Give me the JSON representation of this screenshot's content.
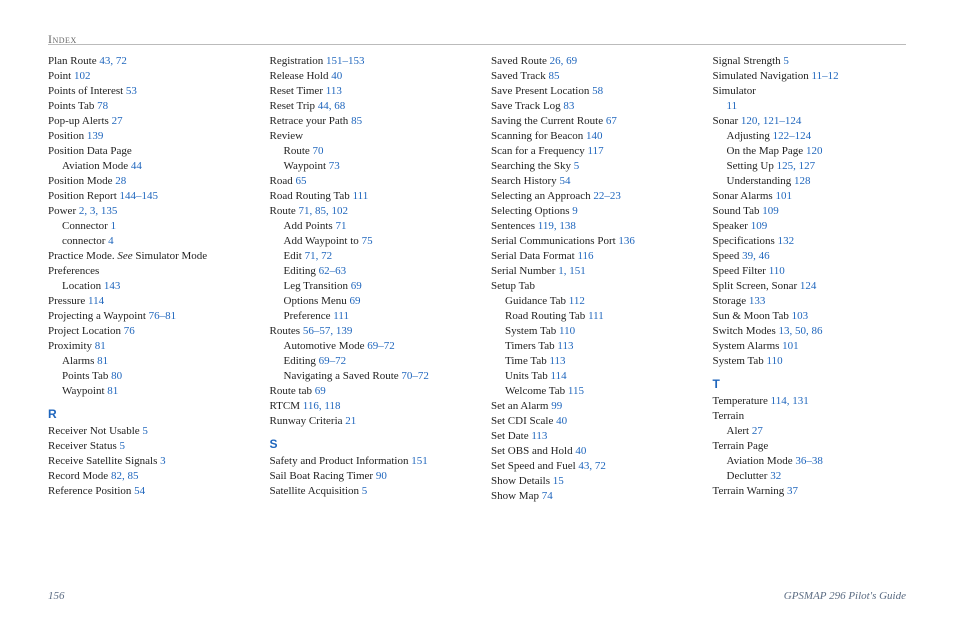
{
  "header": {
    "label": "Index"
  },
  "footer": {
    "page_number": "156",
    "book_title": "GPSMAP 296 Pilot's Guide"
  },
  "columns": [
    {
      "items": [
        {
          "type": "entry",
          "text": "Plan Route",
          "pages": "43, 72"
        },
        {
          "type": "entry",
          "text": "Point",
          "pages": "102"
        },
        {
          "type": "entry",
          "text": "Points of Interest",
          "pages": "53"
        },
        {
          "type": "entry",
          "text": "Points Tab",
          "pages": "78"
        },
        {
          "type": "entry",
          "text": "Pop-up Alerts",
          "pages": "27"
        },
        {
          "type": "entry",
          "text": "Position",
          "pages": "139"
        },
        {
          "type": "entry",
          "text": "Position Data Page"
        },
        {
          "type": "entry",
          "indent": 1,
          "text": "Aviation Mode",
          "pages": "44"
        },
        {
          "type": "entry",
          "text": "Position Mode",
          "pages": "28"
        },
        {
          "type": "entry",
          "text": "Position Report",
          "pages": "144–145"
        },
        {
          "type": "entry",
          "text": "Power",
          "pages": "2, 3, 135"
        },
        {
          "type": "entry",
          "indent": 1,
          "text": "Connector",
          "pages": "1"
        },
        {
          "type": "entry",
          "indent": 1,
          "text": "connector",
          "pages": "4"
        },
        {
          "type": "entry",
          "text": "Practice Mode. ",
          "see": "See",
          "see_target": " Simulator Mode"
        },
        {
          "type": "entry",
          "text": "Preferences"
        },
        {
          "type": "entry",
          "indent": 1,
          "text": "Location",
          "pages": "143"
        },
        {
          "type": "entry",
          "text": "Pressure",
          "pages": "114"
        },
        {
          "type": "entry",
          "text": "Projecting a Waypoint",
          "pages": "76–81"
        },
        {
          "type": "entry",
          "text": "Project Location",
          "pages": "76"
        },
        {
          "type": "entry",
          "text": "Proximity",
          "pages": "81"
        },
        {
          "type": "entry",
          "indent": 1,
          "text": "Alarms",
          "pages": "81"
        },
        {
          "type": "entry",
          "indent": 1,
          "text": "Points Tab",
          "pages": "80"
        },
        {
          "type": "entry",
          "indent": 1,
          "text": "Waypoint",
          "pages": "81"
        },
        {
          "type": "section",
          "letter": "R"
        },
        {
          "type": "entry",
          "text": "Receiver Not Usable",
          "pages": "5"
        },
        {
          "type": "entry",
          "text": "Receiver Status",
          "pages": "5"
        },
        {
          "type": "entry",
          "text": "Receive Satellite Signals",
          "pages": "3"
        },
        {
          "type": "entry",
          "text": "Record Mode",
          "pages": "82, 85"
        },
        {
          "type": "entry",
          "text": "Reference Position",
          "pages": "54"
        }
      ]
    },
    {
      "items": [
        {
          "type": "entry",
          "text": "Registration",
          "pages": "151–153"
        },
        {
          "type": "entry",
          "text": "Release Hold",
          "pages": "40"
        },
        {
          "type": "entry",
          "text": "Reset Timer",
          "pages": "113"
        },
        {
          "type": "entry",
          "text": "Reset Trip",
          "pages": "44, 68"
        },
        {
          "type": "entry",
          "text": "Retrace your Path",
          "pages": "85"
        },
        {
          "type": "entry",
          "text": "Review"
        },
        {
          "type": "entry",
          "indent": 1,
          "text": "Route",
          "pages": "70"
        },
        {
          "type": "entry",
          "indent": 1,
          "text": "Waypoint",
          "pages": "73"
        },
        {
          "type": "entry",
          "text": "Road",
          "pages": "65"
        },
        {
          "type": "entry",
          "text": "Road Routing Tab",
          "pages": "111"
        },
        {
          "type": "entry",
          "text": "Route",
          "pages": "71, 85, 102"
        },
        {
          "type": "entry",
          "indent": 1,
          "text": "Add Points",
          "pages": "71"
        },
        {
          "type": "entry",
          "indent": 1,
          "text": "Add Waypoint to",
          "pages": "75"
        },
        {
          "type": "entry",
          "indent": 1,
          "text": "Edit",
          "pages": "71, 72"
        },
        {
          "type": "entry",
          "indent": 1,
          "text": "Editing",
          "pages": "62–63"
        },
        {
          "type": "entry",
          "indent": 1,
          "text": "Leg Transition",
          "pages": "69"
        },
        {
          "type": "entry",
          "indent": 1,
          "text": "Options Menu",
          "pages": "69"
        },
        {
          "type": "entry",
          "indent": 1,
          "text": "Preference",
          "pages": "111"
        },
        {
          "type": "entry",
          "text": "Routes",
          "pages": "56–57, 139"
        },
        {
          "type": "entry",
          "indent": 1,
          "text": "Automotive Mode",
          "pages": "69–72"
        },
        {
          "type": "entry",
          "indent": 1,
          "text": "Editing",
          "pages": "69–72"
        },
        {
          "type": "entry",
          "indent": 1,
          "text": "Navigating a Saved Route",
          "pages": "70–72"
        },
        {
          "type": "entry",
          "text": "Route tab",
          "pages": "69"
        },
        {
          "type": "entry",
          "text": "RTCM",
          "pages": "116, 118"
        },
        {
          "type": "entry",
          "text": "Runway Criteria",
          "pages": "21"
        },
        {
          "type": "section",
          "letter": "S"
        },
        {
          "type": "entry",
          "text": "Safety and Product Information",
          "pages": "151"
        },
        {
          "type": "entry",
          "text": "Sail Boat Racing Timer",
          "pages": "90"
        },
        {
          "type": "entry",
          "text": "Satellite Acquisition",
          "pages": "5"
        }
      ]
    },
    {
      "items": [
        {
          "type": "entry",
          "text": "Saved Route",
          "pages": "26, 69"
        },
        {
          "type": "entry",
          "text": "Saved Track",
          "pages": "85"
        },
        {
          "type": "entry",
          "text": "Save Present Location",
          "pages": "58"
        },
        {
          "type": "entry",
          "text": "Save Track Log",
          "pages": "83"
        },
        {
          "type": "entry",
          "text": "Saving the Current Route",
          "pages": "67"
        },
        {
          "type": "entry",
          "text": "Scanning for Beacon",
          "pages": "140"
        },
        {
          "type": "entry",
          "text": "Scan for a Frequency",
          "pages": "117"
        },
        {
          "type": "entry",
          "text": "Searching the Sky",
          "pages": "5"
        },
        {
          "type": "entry",
          "text": "Search History",
          "pages": "54"
        },
        {
          "type": "entry",
          "text": "Selecting an Approach",
          "pages": "22–23"
        },
        {
          "type": "entry",
          "text": "Selecting Options",
          "pages": "9"
        },
        {
          "type": "entry",
          "text": "Sentences",
          "pages": "119, 138"
        },
        {
          "type": "entry",
          "text": "Serial Communications Port",
          "pages": "136"
        },
        {
          "type": "entry",
          "text": "Serial Data Format",
          "pages": "116"
        },
        {
          "type": "entry",
          "text": "Serial Number",
          "pages": "1, 151"
        },
        {
          "type": "entry",
          "text": "Setup Tab"
        },
        {
          "type": "entry",
          "indent": 1,
          "text": "Guidance Tab",
          "pages": "112"
        },
        {
          "type": "entry",
          "indent": 1,
          "text": "Road Routing Tab",
          "pages": "111"
        },
        {
          "type": "entry",
          "indent": 1,
          "text": "System Tab",
          "pages": "110"
        },
        {
          "type": "entry",
          "indent": 1,
          "text": "Timers Tab",
          "pages": "113"
        },
        {
          "type": "entry",
          "indent": 1,
          "text": "Time Tab",
          "pages": "113"
        },
        {
          "type": "entry",
          "indent": 1,
          "text": "Units Tab",
          "pages": "114"
        },
        {
          "type": "entry",
          "indent": 1,
          "text": "Welcome Tab",
          "pages": "115"
        },
        {
          "type": "entry",
          "text": "Set an Alarm",
          "pages": "99"
        },
        {
          "type": "entry",
          "text": "Set CDI Scale",
          "pages": "40"
        },
        {
          "type": "entry",
          "text": "Set Date",
          "pages": "113"
        },
        {
          "type": "entry",
          "text": "Set OBS and Hold",
          "pages": "40"
        },
        {
          "type": "entry",
          "text": "Set Speed and Fuel",
          "pages": "43, 72"
        },
        {
          "type": "entry",
          "text": "Show Details",
          "pages": "15"
        },
        {
          "type": "entry",
          "text": "Show Map",
          "pages": "74"
        }
      ]
    },
    {
      "items": [
        {
          "type": "entry",
          "text": "Signal Strength",
          "pages": "5"
        },
        {
          "type": "entry",
          "text": "Simulated Navigation",
          "pages": "11–12"
        },
        {
          "type": "entry",
          "text": "Simulator"
        },
        {
          "type": "entry",
          "indent": 1,
          "text": "",
          "pages": "11"
        },
        {
          "type": "entry",
          "text": "Sonar",
          "pages": "120, 121–124"
        },
        {
          "type": "entry",
          "indent": 1,
          "text": "Adjusting",
          "pages": "122–124"
        },
        {
          "type": "entry",
          "indent": 1,
          "text": "On the Map Page",
          "pages": "120"
        },
        {
          "type": "entry",
          "indent": 1,
          "text": "Setting Up",
          "pages": "125, 127"
        },
        {
          "type": "entry",
          "indent": 1,
          "text": "Understanding",
          "pages": "128"
        },
        {
          "type": "entry",
          "text": "Sonar Alarms",
          "pages": "101"
        },
        {
          "type": "entry",
          "text": "Sound Tab",
          "pages": "109"
        },
        {
          "type": "entry",
          "text": "Speaker",
          "pages": "109"
        },
        {
          "type": "entry",
          "text": "Specifications",
          "pages": "132"
        },
        {
          "type": "entry",
          "text": "Speed",
          "pages": "39, 46"
        },
        {
          "type": "entry",
          "text": "Speed Filter",
          "pages": "110"
        },
        {
          "type": "entry",
          "text": "Split Screen, Sonar",
          "pages": "124"
        },
        {
          "type": "entry",
          "text": "Storage",
          "pages": "133"
        },
        {
          "type": "entry",
          "text": "Sun & Moon Tab",
          "pages": "103"
        },
        {
          "type": "entry",
          "text": "Switch Modes",
          "pages": "13, 50, 86"
        },
        {
          "type": "entry",
          "text": "System Alarms",
          "pages": "101"
        },
        {
          "type": "entry",
          "text": "System Tab",
          "pages": "110"
        },
        {
          "type": "section",
          "letter": "T"
        },
        {
          "type": "entry",
          "text": "Temperature",
          "pages": "114, 131"
        },
        {
          "type": "entry",
          "text": "Terrain"
        },
        {
          "type": "entry",
          "indent": 1,
          "text": "Alert",
          "pages": "27"
        },
        {
          "type": "entry",
          "text": "Terrain Page"
        },
        {
          "type": "entry",
          "indent": 1,
          "text": "Aviation Mode",
          "pages": "36–38"
        },
        {
          "type": "entry",
          "indent": 1,
          "text": "Declutter",
          "pages": "32"
        },
        {
          "type": "entry",
          "text": "Terrain Warning",
          "pages": "37"
        }
      ]
    }
  ]
}
